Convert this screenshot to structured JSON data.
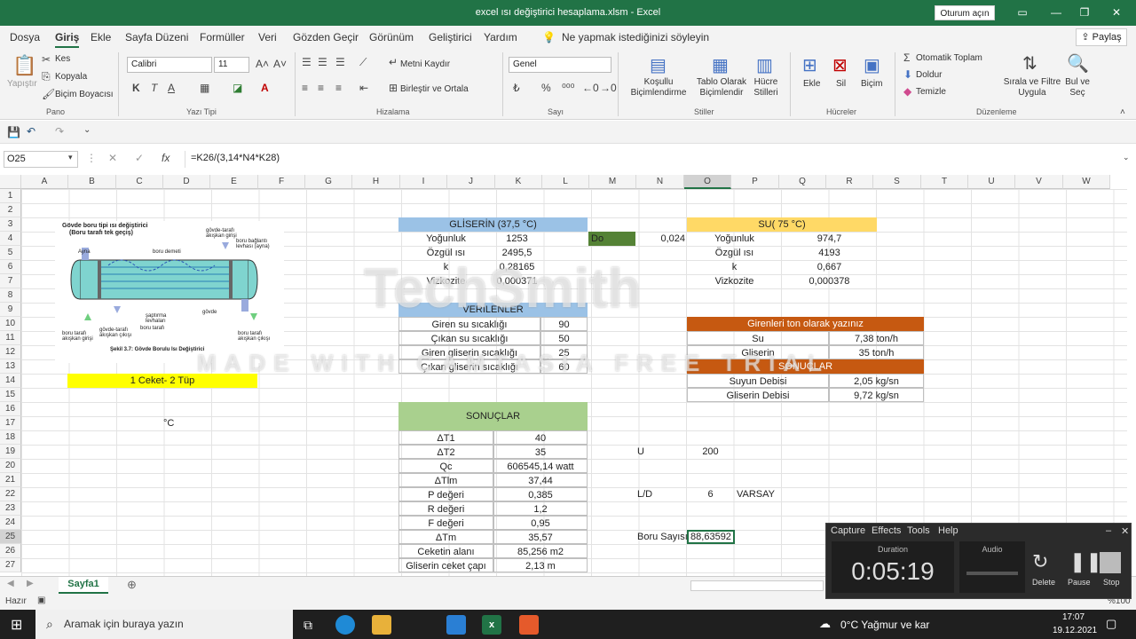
{
  "window": {
    "title": "excel ısı değiştirici hesaplama.xlsm  -  Excel",
    "signin": "Oturum açın"
  },
  "menus": [
    "Dosya",
    "Giriş",
    "Ekle",
    "Sayfa Düzeni",
    "Formüller",
    "Veri",
    "Gözden Geçir",
    "Görünüm",
    "Geliştirici",
    "Yardım"
  ],
  "tell_me": "Ne yapmak istediğinizi söyleyin",
  "share": "Paylaş",
  "ribbon": {
    "clipboard": {
      "paste": "Yapıştır",
      "cut": "Kes",
      "copy": "Kopyala",
      "painter": "Biçim Boyacısı",
      "group": "Pano"
    },
    "font": {
      "name": "Calibri",
      "size": "11",
      "bold": "K",
      "italic": "T",
      "underline": "A",
      "group": "Yazı Tipi"
    },
    "align": {
      "wrap": "Metni Kaydır",
      "merge": "Birleştir ve Ortala",
      "group": "Hizalama"
    },
    "number": {
      "format": "Genel",
      "group": "Sayı"
    },
    "styles": {
      "cond": "Koşullu Biçimlendirme",
      "table": "Tablo Olarak Biçimlendir",
      "cell": "Hücre Stilleri",
      "group": "Stiller"
    },
    "cells": {
      "insert": "Ekle",
      "delete": "Sil",
      "format": "Biçim",
      "group": "Hücreler"
    },
    "editing": {
      "autosum": "Otomatik Toplam",
      "fill": "Doldur",
      "clear": "Temizle",
      "sort": "Sırala ve Filtre Uygula",
      "find": "Bul ve Seç",
      "group": "Düzenleme"
    }
  },
  "formula_bar": {
    "namebox": "O25",
    "fx": "fx",
    "formula": "=K26/(3,14*N4*K28)"
  },
  "columns": [
    "A",
    "B",
    "C",
    "D",
    "E",
    "F",
    "G",
    "H",
    "I",
    "J",
    "K",
    "L",
    "M",
    "N",
    "O",
    "P",
    "Q",
    "R",
    "S",
    "T",
    "U",
    "V",
    "W"
  ],
  "rows": [
    "1",
    "2",
    "3",
    "4",
    "5",
    "6",
    "7",
    "8",
    "9",
    "10",
    "11",
    "12",
    "13",
    "14",
    "15",
    "16",
    "17",
    "18",
    "19",
    "20",
    "21",
    "22",
    "23",
    "24",
    "25",
    "26",
    "27"
  ],
  "figure": {
    "title1": "Gövde boru tipi ısı değiştirici",
    "title2": "(Boru tarafı tek geçiş)",
    "caption": "Şekil 3.7: Gövde Borulu Isı Değiştirici",
    "labels": [
      "Ayna",
      "boru demeti",
      "gövde-tarafı akışkan girişi",
      "boru bağlantı levhası (ayna)",
      "şaptırma levhaları",
      "gövde",
      "boru tarafı akışkan girişi",
      "gövde-tarafı akışkan çıkışı",
      "boru tarafı",
      "boru tarafı akışkan çıkışı"
    ]
  },
  "cells": {
    "b14": "1 Ceket- 2 Tüp",
    "c17": "°C",
    "gliserin": {
      "header": "GLİSERİN (37,5 °C)",
      "rows": [
        [
          "Yoğunluk",
          "1253"
        ],
        [
          "Özgül ısı",
          "2495,5"
        ],
        [
          "k",
          "0,28165"
        ],
        [
          "Vizkozite",
          "0,000371"
        ]
      ]
    },
    "do": {
      "label": "Do",
      "value": "0,024"
    },
    "su": {
      "header": "SU( 75 °C)",
      "rows": [
        [
          "Yoğunluk",
          "974,7"
        ],
        [
          "Özgül ısı",
          "4193"
        ],
        [
          "k",
          "0,667"
        ],
        [
          "Vizkozite",
          "0,000378"
        ]
      ]
    },
    "verilenler": {
      "header": "VERİLENLER",
      "rows": [
        [
          "Giren su sıcaklığı",
          "90"
        ],
        [
          "Çıkan su sıcaklığı",
          "50"
        ],
        [
          "Giren gliserin sıcaklığı",
          "25"
        ],
        [
          "Çıkan gliserin sıcaklığı",
          "60"
        ]
      ]
    },
    "girenler": {
      "header": "Girenleri ton olarak yazınız",
      "rows": [
        [
          "Su",
          "7,38 ton/h"
        ],
        [
          "Gliserin",
          "35 ton/h"
        ]
      ]
    },
    "sonuclar_small": {
      "header": "SONUÇLAR",
      "rows": [
        [
          "Suyun Debisi",
          "2,05 kg/sn"
        ],
        [
          "Gliserin Debisi",
          "9,72 kg/sn"
        ]
      ]
    },
    "sonuclar": {
      "header": "SONUÇLAR",
      "rows": [
        [
          "ΔT1",
          "40"
        ],
        [
          "ΔT2",
          "35"
        ],
        [
          "Qc",
          "606545,14 watt"
        ],
        [
          "ΔTlm",
          "37,44"
        ],
        [
          "P değeri",
          "0,385"
        ],
        [
          "R değeri",
          "1,2"
        ],
        [
          "F değeri",
          "0,95"
        ],
        [
          "ΔTm",
          "35,57"
        ],
        [
          "Ceketin alanı",
          "85,256 m2"
        ],
        [
          "Gliserin ceket çapı",
          "2,13 m"
        ]
      ]
    },
    "u": {
      "label": "U",
      "value": "200"
    },
    "ld": {
      "label": "L/D",
      "value": "6",
      "note": "VARSAY"
    },
    "boru": {
      "label": "Boru Sayısı",
      "value": "88,63592"
    }
  },
  "sheet_tab": "Sayfa1",
  "status": {
    "ready": "Hazır",
    "zoom": "%100"
  },
  "taskbar": {
    "search": "Aramak için buraya yazın",
    "weather": "0°C  Yağmur ve kar",
    "time": "17:07",
    "date": "19.12.2021"
  },
  "recorder": {
    "menu": [
      "Capture",
      "Effects",
      "Tools",
      "Help"
    ],
    "duration_label": "Duration",
    "audio_label": "Audio",
    "duration": "0:05:19",
    "delete": "Delete",
    "pause": "Pause",
    "stop": "Stop"
  },
  "watermark": {
    "line1": "TechSmith",
    "line2": "MADE WITH CAMTASIA FREE TRIAL"
  },
  "colors": {
    "excel_green": "#217346",
    "blue_header": "#9bc2e6",
    "yellow_header": "#ffd966",
    "green_header": "#a9d08e",
    "orange_header": "#c65911",
    "do_green": "#548235",
    "yellow_cell": "#ffff00"
  }
}
